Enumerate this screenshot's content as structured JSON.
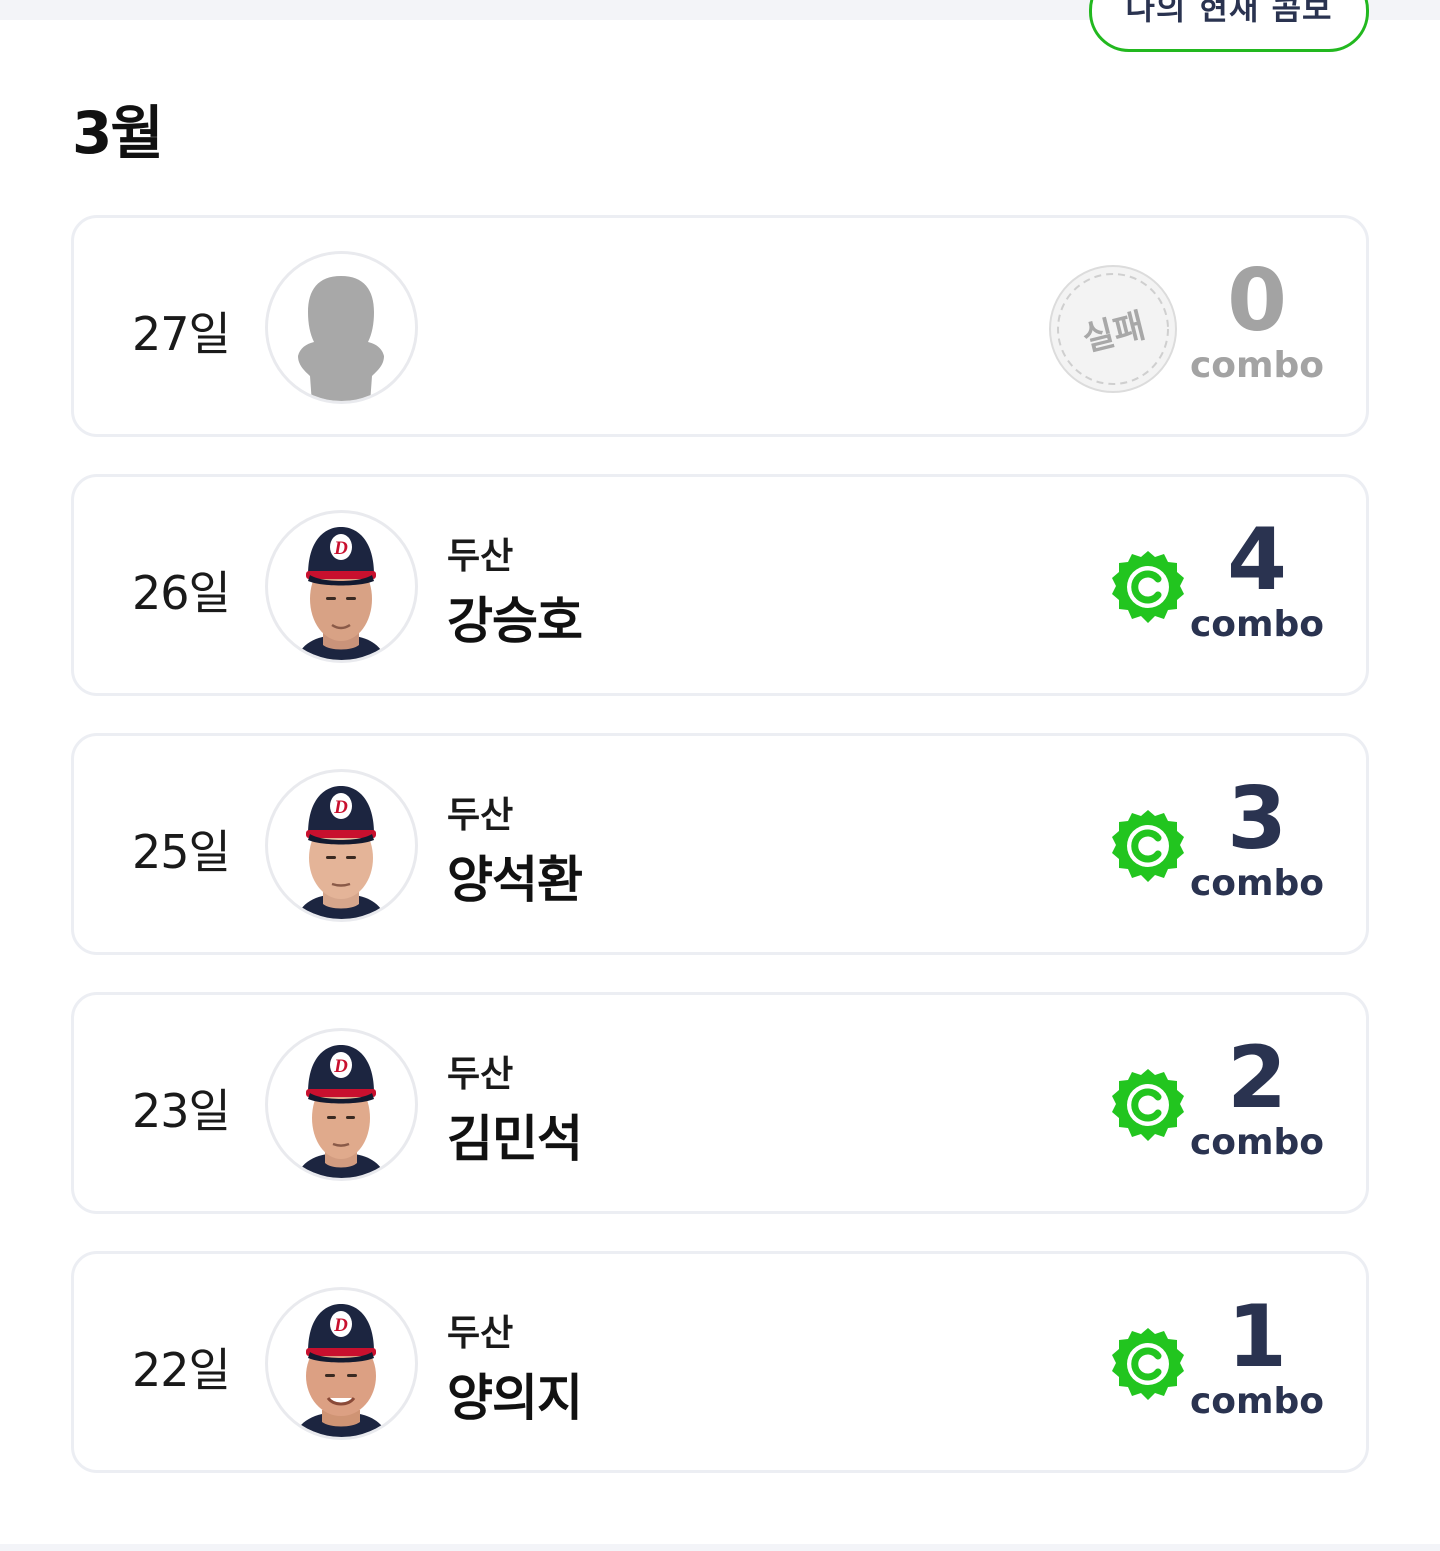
{
  "header": {
    "combo_button_label": "나의 현재 콤보"
  },
  "month": {
    "title": "3월"
  },
  "combo_suffix": "combo",
  "entries": [
    {
      "day": "27일",
      "team": "",
      "player": "",
      "status": "실패",
      "combo": "0",
      "state": "fail"
    },
    {
      "day": "26일",
      "team": "두산",
      "player": "강승호",
      "status": "",
      "combo": "4",
      "state": "success"
    },
    {
      "day": "25일",
      "team": "두산",
      "player": "양석환",
      "status": "",
      "combo": "3",
      "state": "success"
    },
    {
      "day": "23일",
      "team": "두산",
      "player": "김민석",
      "status": "",
      "combo": "2",
      "state": "success"
    },
    {
      "day": "22일",
      "team": "두산",
      "player": "양의지",
      "status": "",
      "combo": "1",
      "state": "success"
    }
  ],
  "colors": {
    "accent_green": "#22c51f",
    "combo_text": "#2a3350",
    "fail_gray": "#a3a3a3",
    "cap_navy": "#1c2540",
    "cap_red": "#c8102e"
  },
  "icons": {
    "success_badge": "c-seal-icon",
    "fail_badge": "fail-stamp-icon",
    "placeholder_avatar": "silhouette-icon"
  }
}
